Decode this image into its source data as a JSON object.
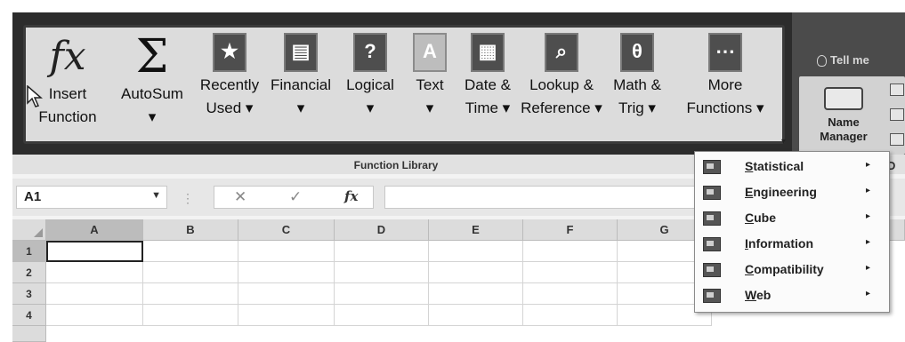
{
  "ribbon": {
    "function_library": {
      "group_label": "Function Library",
      "buttons": [
        {
          "id": "insert-function",
          "label": "Insert\nFunction",
          "icon": "fx-icon",
          "glyph": "fx"
        },
        {
          "id": "autosum",
          "label": "AutoSum\n▾",
          "icon": "sigma-icon",
          "glyph": "Σ"
        },
        {
          "id": "recently-used",
          "label": "Recently\nUsed ▾",
          "icon": "star-book-icon",
          "glyph": "★"
        },
        {
          "id": "financial",
          "label": "Financial\n▾",
          "icon": "financial-book-icon",
          "glyph": "▤"
        },
        {
          "id": "logical",
          "label": "Logical\n▾",
          "icon": "question-book-icon",
          "glyph": "?"
        },
        {
          "id": "text",
          "label": "Text\n▾",
          "icon": "text-book-icon",
          "glyph": "A"
        },
        {
          "id": "date-time",
          "label": "Date &\nTime ▾",
          "icon": "calendar-book-icon",
          "glyph": "▦"
        },
        {
          "id": "lookup-reference",
          "label": "Lookup &\nReference ▾",
          "icon": "magnifier-book-icon",
          "glyph": "⌕"
        },
        {
          "id": "math-trig",
          "label": "Math &\nTrig ▾",
          "icon": "theta-book-icon",
          "glyph": "θ"
        },
        {
          "id": "more-functions",
          "label": "More\nFunctions ▾",
          "icon": "more-book-icon",
          "glyph": "⋯"
        }
      ]
    },
    "defined_names": {
      "name_manager_label": "Name\nManager",
      "group_label_fragment": "D"
    },
    "tell_me": "Tell me"
  },
  "formula_bar": {
    "name_box": "A1",
    "cancel_glyph": "✕",
    "enter_glyph": "✓",
    "fx_glyph": "fx",
    "formula": ""
  },
  "sheet": {
    "columns": [
      "A",
      "B",
      "C",
      "D",
      "E",
      "F",
      "G"
    ],
    "rows": [
      "1",
      "2",
      "3",
      "4"
    ],
    "active_cell": "A1"
  },
  "more_functions_menu": {
    "items": [
      {
        "accel": "S",
        "rest": "tatistical",
        "icon": "statistical-icon"
      },
      {
        "accel": "E",
        "rest": "ngineering",
        "icon": "engineering-icon"
      },
      {
        "accel": "C",
        "rest": "ube",
        "icon": "cube-icon"
      },
      {
        "accel": "I",
        "rest": "nformation",
        "icon": "information-icon"
      },
      {
        "accel": "C",
        "rest": "ompatibility",
        "icon": "compatibility-icon"
      },
      {
        "accel": "W",
        "rest": "eb",
        "icon": "web-icon"
      }
    ],
    "submenu_arrow": "▸"
  }
}
